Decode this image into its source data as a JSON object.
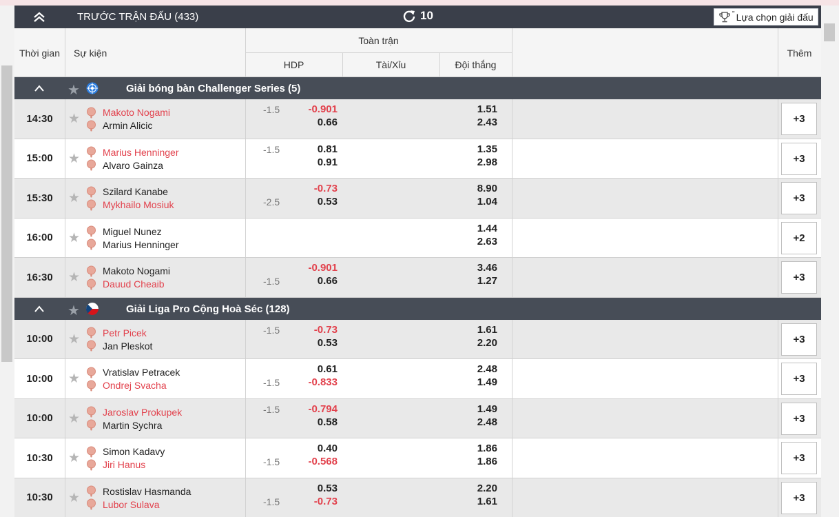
{
  "topbar": {
    "title": "TRƯỚC TRẬN ĐẤU (433)",
    "refresh_count": "10",
    "select_league": "Lựa chọn giải đấu"
  },
  "header": {
    "time": "Thời gian",
    "event": "Sự kiện",
    "full_match": "Toàn trận",
    "hdp": "HDP",
    "over_under": "Tài/Xỉu",
    "winner": "Đội thắng",
    "more": "Thêm"
  },
  "colors": {
    "favorite": "#e2414c",
    "topbar": "#3a3f4a",
    "league_bar": "#474d57"
  },
  "leagues": [
    {
      "name": "Giải bóng bàn Challenger Series (5)",
      "flag_icon": "international-icon",
      "matches": [
        {
          "time": "14:30",
          "team1": "Makoto Nogami",
          "team2": "Armin Alicic",
          "fav": 1,
          "hdp_line": "-1.5",
          "hdp_line_row": 1,
          "hdp1": "-0.901",
          "hdp2": "0.66",
          "win1": "1.51",
          "win2": "2.43",
          "more": "+3"
        },
        {
          "time": "15:00",
          "team1": "Marius Henninger",
          "team2": "Alvaro Gainza",
          "fav": 1,
          "hdp_line": "-1.5",
          "hdp_line_row": 1,
          "hdp1": "0.81",
          "hdp2": "0.91",
          "win1": "1.35",
          "win2": "2.98",
          "more": "+3"
        },
        {
          "time": "15:30",
          "team1": "Szilard Kanabe",
          "team2": "Mykhailo Mosiuk",
          "fav": 2,
          "hdp_line": "-2.5",
          "hdp_line_row": 2,
          "hdp1": "-0.73",
          "hdp2": "0.53",
          "win1": "8.90",
          "win2": "1.04",
          "more": "+3"
        },
        {
          "time": "16:00",
          "team1": "Miguel Nunez",
          "team2": "Marius Henninger",
          "fav": 0,
          "hdp_line": "",
          "hdp_line_row": 0,
          "hdp1": "",
          "hdp2": "",
          "win1": "1.44",
          "win2": "2.63",
          "more": "+2"
        },
        {
          "time": "16:30",
          "team1": "Makoto Nogami",
          "team2": "Dauud Cheaib",
          "fav": 2,
          "hdp_line": "-1.5",
          "hdp_line_row": 2,
          "hdp1": "-0.901",
          "hdp2": "0.66",
          "win1": "3.46",
          "win2": "1.27",
          "more": "+3"
        }
      ]
    },
    {
      "name": "Giải Liga Pro Cộng Hoà Séc (128)",
      "flag_icon": "czech-flag-icon",
      "matches": [
        {
          "time": "10:00",
          "team1": "Petr Picek",
          "team2": "Jan Pleskot",
          "fav": 1,
          "hdp_line": "-1.5",
          "hdp_line_row": 1,
          "hdp1": "-0.73",
          "hdp2": "0.53",
          "win1": "1.61",
          "win2": "2.20",
          "more": "+3"
        },
        {
          "time": "10:00",
          "team1": "Vratislav Petracek",
          "team2": "Ondrej Svacha",
          "fav": 2,
          "hdp_line": "-1.5",
          "hdp_line_row": 2,
          "hdp1": "0.61",
          "hdp2": "-0.833",
          "win1": "2.48",
          "win2": "1.49",
          "more": "+3"
        },
        {
          "time": "10:00",
          "team1": "Jaroslav Prokupek",
          "team2": "Martin Sychra",
          "fav": 1,
          "hdp_line": "-1.5",
          "hdp_line_row": 1,
          "hdp1": "-0.794",
          "hdp2": "0.58",
          "win1": "1.49",
          "win2": "2.48",
          "more": "+3"
        },
        {
          "time": "10:30",
          "team1": "Simon Kadavy",
          "team2": "Jiri Hanus",
          "fav": 2,
          "hdp_line": "-1.5",
          "hdp_line_row": 2,
          "hdp1": "0.40",
          "hdp2": "-0.568",
          "win1": "1.86",
          "win2": "1.86",
          "more": "+3"
        },
        {
          "time": "10:30",
          "team1": "Rostislav Hasmanda",
          "team2": "Lubor Sulava",
          "fav": 2,
          "hdp_line": "-1.5",
          "hdp_line_row": 2,
          "hdp1": "0.53",
          "hdp2": "-0.73",
          "win1": "2.20",
          "win2": "1.61",
          "more": "+3"
        }
      ]
    }
  ]
}
